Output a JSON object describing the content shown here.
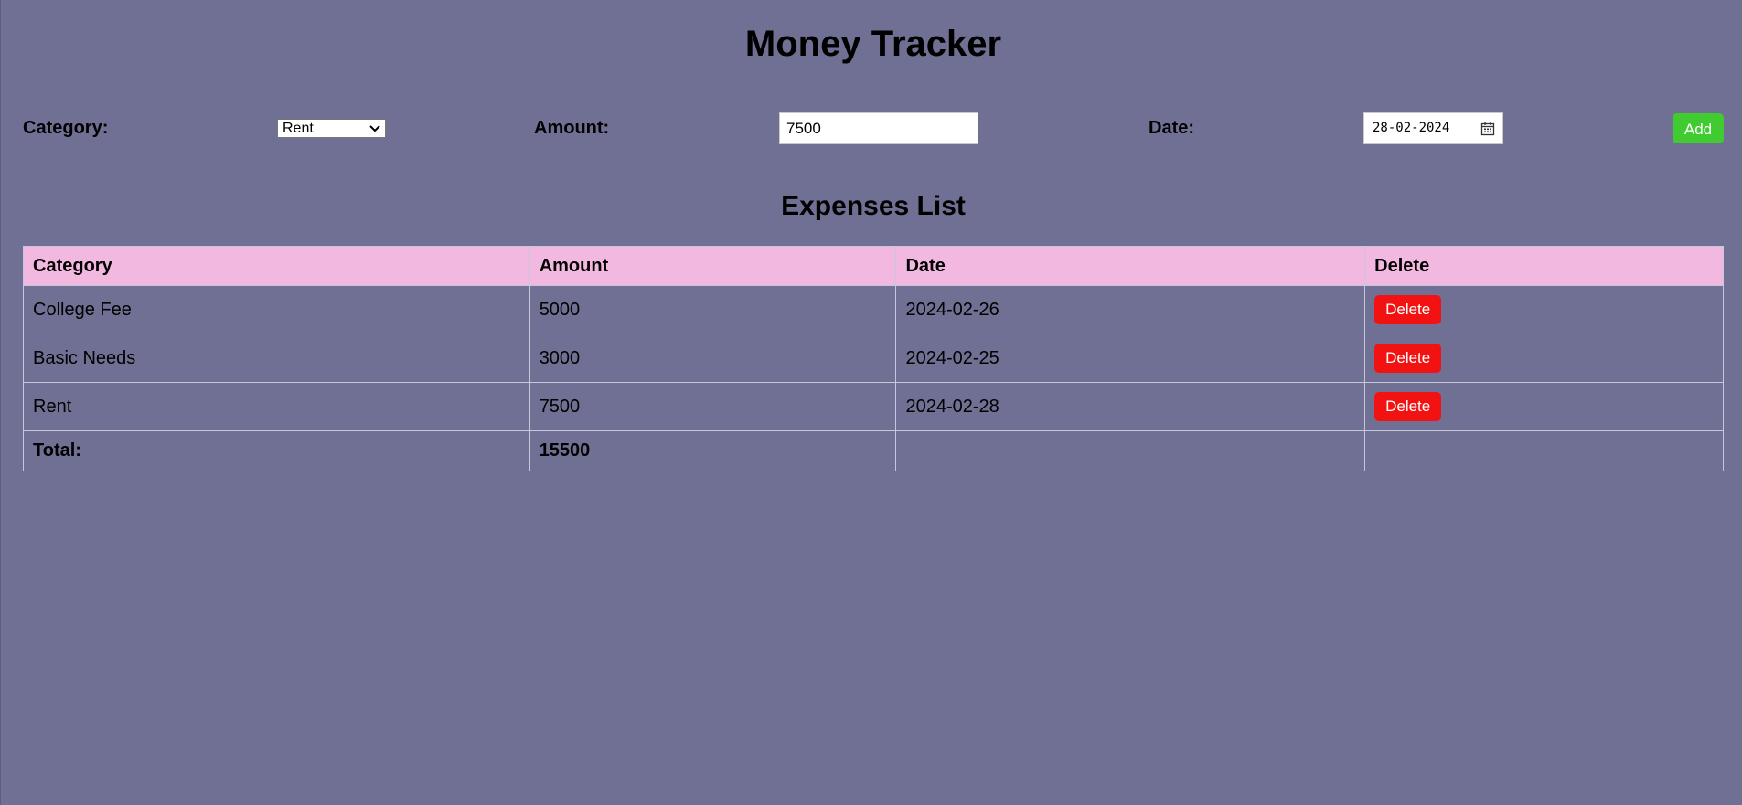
{
  "page": {
    "title": "Money Tracker",
    "background": "#707094"
  },
  "form": {
    "category_label": "Category:",
    "category_selected": "Rent",
    "amount_label": "Amount:",
    "amount_value": "7500",
    "date_label": "Date:",
    "date_value": "28-02-2024",
    "add_label": "Add",
    "add_color": "#40cc30"
  },
  "expenses": {
    "heading": "Expenses List",
    "columns": [
      "Category",
      "Amount",
      "Date",
      "Delete"
    ],
    "rows": [
      {
        "category": "College Fee",
        "amount": "5000",
        "date": "2024-02-26",
        "delete_label": "Delete"
      },
      {
        "category": "Basic Needs",
        "amount": "3000",
        "date": "2024-02-25",
        "delete_label": "Delete"
      },
      {
        "category": "Rent",
        "amount": "7500",
        "date": "2024-02-28",
        "delete_label": "Delete"
      }
    ],
    "total_label": "Total:",
    "total_value": "15500",
    "header_color": "#f2b8e0",
    "delete_color": "#f21212"
  }
}
